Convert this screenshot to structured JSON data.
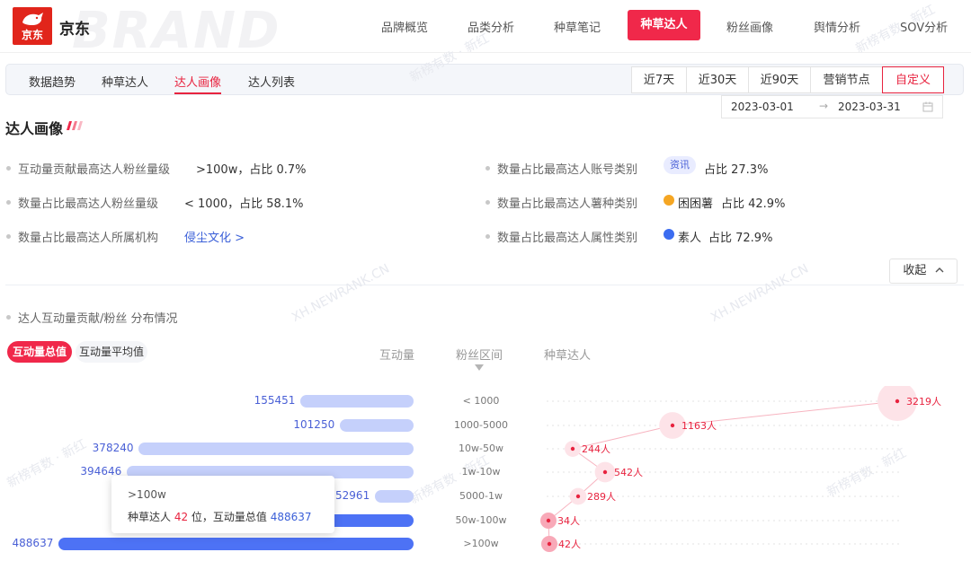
{
  "brand": {
    "logo_text": "京东",
    "name": "京东",
    "bg_word": "BRAND"
  },
  "top_nav": {
    "items": [
      "品牌概览",
      "品类分析",
      "种草笔记",
      "种草达人",
      "粉丝画像",
      "舆情分析",
      "SOV分析"
    ],
    "active_index": 3
  },
  "sub_tabs": {
    "items": [
      "数据趋势",
      "种草达人",
      "达人画像",
      "达人列表"
    ],
    "active_index": 2
  },
  "date_ranges": {
    "items": [
      "近7天",
      "近30天",
      "近90天",
      "营销节点",
      "自定义"
    ],
    "active_index": 4
  },
  "date_picker": {
    "start": "2023-03-01",
    "arrow": "→",
    "end": "2023-03-31"
  },
  "section_title": "达人画像",
  "stats": {
    "left": [
      {
        "label": "互动量贡献最高达人粉丝量级",
        "value": ">100w，占比 0.7%"
      },
      {
        "label": "数量占比最高达人粉丝量级",
        "value": "< 1000，占比 58.1%"
      },
      {
        "label": "数量占比最高达人所属机构",
        "value": "侵尘文化 >"
      }
    ],
    "right": [
      {
        "label": "数量占比最高达人账号类别",
        "tag": "资讯",
        "value": "占比 27.3%"
      },
      {
        "label": "数量占比最高达人薯种类别",
        "tag": "困困薯",
        "value": "占比 42.9%"
      },
      {
        "label": "数量占比最高达人属性类别",
        "tag": "素人",
        "value": "占比 72.9%"
      }
    ]
  },
  "collapse_label": "收起",
  "chart_section_label": "达人互动量贡献/粉丝 分布情况",
  "toggles": {
    "active": "互动量总值",
    "inactive": "互动量平均值"
  },
  "column_headers": {
    "interaction": "互动量",
    "fan_range": "粉丝区间",
    "kol": "种草达人"
  },
  "watermarks": [
    "新榜有数 · 新红",
    "XH.NEWRANK.CN"
  ],
  "colors": {
    "accent": "#f0284a",
    "bar_light": "#c5d0fb",
    "bar_dark": "#4d72f5",
    "link": "#3a5fd8"
  },
  "chart_data": {
    "type": "bar",
    "categories": [
      "< 1000",
      "1000-5000",
      "10w-50w",
      "1w-10w",
      "5000-1w",
      "50w-100w",
      ">100w"
    ],
    "series": [
      {
        "name": "互动量",
        "values": [
          155451,
          101250,
          378240,
          394646,
          52961,
          300000,
          488637
        ]
      },
      {
        "name": "种草达人",
        "values": [
          3219,
          1163,
          244,
          542,
          289,
          34,
          42
        ]
      }
    ],
    "value_labels": [
      "155451",
      "101250",
      "378240",
      "394646",
      "52961",
      "",
      "488637"
    ],
    "kol_labels": [
      "3219人",
      "1163人",
      "244人",
      "542人",
      "289人",
      "34人",
      "42人"
    ],
    "highlighted_categories": [
      "50w-100w",
      ">100w"
    ]
  },
  "tooltip": {
    "title": ">100w",
    "prefix": "种草达人 ",
    "count": "42",
    "middle": " 位，互动量总值 ",
    "total": "488637"
  }
}
